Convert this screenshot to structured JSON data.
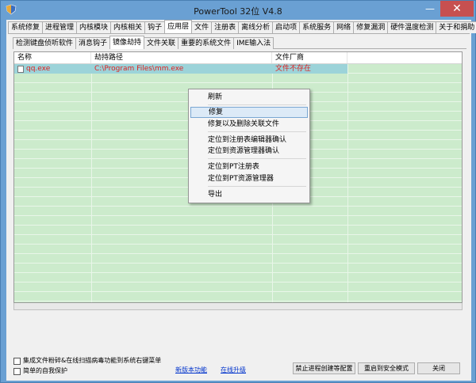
{
  "window": {
    "title": "PowerTool 32位 V4.8",
    "minimize": "—",
    "close": "✕"
  },
  "main_tabs": [
    {
      "label": "系统修复"
    },
    {
      "label": "进程管理"
    },
    {
      "label": "内核模块"
    },
    {
      "label": "内核相关"
    },
    {
      "label": "钩子"
    },
    {
      "label": "应用层"
    },
    {
      "label": "文件"
    },
    {
      "label": "注册表"
    },
    {
      "label": "离线分析"
    },
    {
      "label": "启动项"
    },
    {
      "label": "系统服务"
    },
    {
      "label": "网络"
    },
    {
      "label": "修复漏洞"
    },
    {
      "label": "硬件温度检测"
    },
    {
      "label": "关于和捐助"
    }
  ],
  "sub_tabs": [
    {
      "label": "检测键盘侦听软件"
    },
    {
      "label": "消息钩子"
    },
    {
      "label": "镜像劫持"
    },
    {
      "label": "文件关联"
    },
    {
      "label": "重要的系统文件"
    },
    {
      "label": "IME输入法"
    }
  ],
  "table": {
    "columns": [
      "名称",
      "劫持路径",
      "文件厂商"
    ],
    "rows": [
      {
        "name": "qq.exe",
        "path": "C:\\Program Files\\mm.exe",
        "vendor": "文件不存在"
      }
    ]
  },
  "context_menu": {
    "items": [
      "刷新",
      "修复",
      "修复以及删除关联文件",
      "定位到注册表编辑器确认",
      "定位到资源管理器确认",
      "定位到PT注册表",
      "定位到PT资源管理器",
      "导出"
    ]
  },
  "bottom": {
    "checkbox1": "集成文件粉碎&在线扫描病毒功能到系统右键菜单",
    "checkbox2": "简单的自我保护",
    "link_new": "新版本功能",
    "link_update": "在线升级",
    "btn_config": "禁止进程创建等配置",
    "btn_restart": "重启到安全模式",
    "btn_close": "关闭"
  }
}
